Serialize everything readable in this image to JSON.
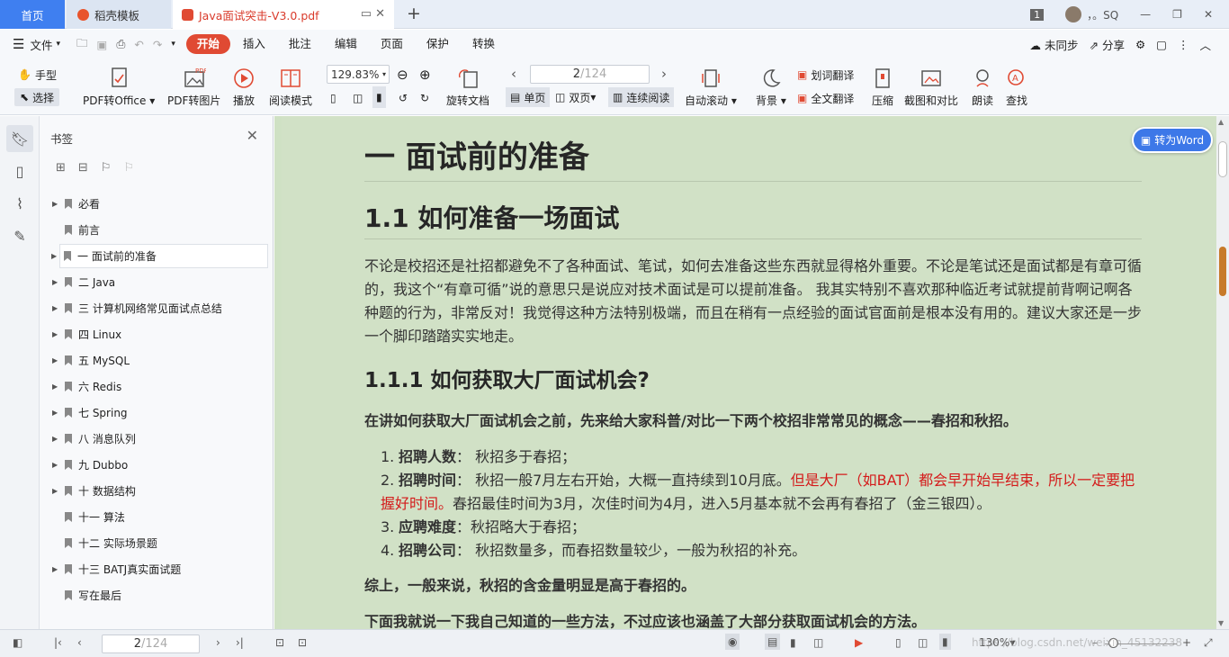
{
  "tabs": {
    "home": "首页",
    "docer": "稻壳模板",
    "pdf": "Java面试突击-V3.0.pdf",
    "new_tab": "+"
  },
  "window": {
    "badge": "1",
    "user": "，。SQ"
  },
  "ribbon": {
    "file": "文件",
    "tabs": [
      "开始",
      "插入",
      "批注",
      "编辑",
      "页面",
      "保护",
      "转换"
    ],
    "active_tab": "开始",
    "sync": "未同步",
    "share": "分享"
  },
  "toolbar": {
    "hand": "手型",
    "select": "选择",
    "pdf_to_office": "PDF转Office",
    "pdf_to_image": "PDF转图片",
    "play": "播放",
    "read_mode": "阅读模式",
    "zoom": "129.83%",
    "rotate": "旋转文档",
    "page_current": "2",
    "page_total": "/124",
    "single": "单页",
    "double": "双页",
    "continuous": "连续阅读",
    "auto_scroll": "自动滚动",
    "background": "背景",
    "word_translate": "划词翻译",
    "full_translate": "全文翻译",
    "compress": "压缩",
    "screenshot": "截图和对比",
    "read_aloud": "朗读",
    "find": "查找"
  },
  "sidebar": {
    "title": "书签",
    "items": [
      {
        "label": "必看",
        "arrow": true
      },
      {
        "label": "前言",
        "arrow": false
      },
      {
        "label": "一 面试前的准备",
        "arrow": true,
        "selected": true
      },
      {
        "label": "二 Java",
        "arrow": true
      },
      {
        "label": "三  计算机网络常见面试点总结",
        "arrow": true
      },
      {
        "label": "四 Linux",
        "arrow": true
      },
      {
        "label": "五 MySQL",
        "arrow": true
      },
      {
        "label": "六 Redis",
        "arrow": true
      },
      {
        "label": "七 Spring",
        "arrow": true
      },
      {
        "label": "八 消息队列",
        "arrow": true
      },
      {
        "label": "九 Dubbo",
        "arrow": true
      },
      {
        "label": "十 数据结构",
        "arrow": true
      },
      {
        "label": "十一 算法",
        "arrow": false
      },
      {
        "label": "十二 实际场景题",
        "arrow": false
      },
      {
        "label": "十三 BATJ真实面试题",
        "arrow": true
      },
      {
        "label": "写在最后",
        "arrow": false
      }
    ]
  },
  "doc": {
    "h1": "一 面试前的准备",
    "h2": "1.1 如何准备一场面试",
    "para1": "不论是校招还是社招都避免不了各种面试、笔试，如何去准备这些东西就显得格外重要。不论是笔试还是面试都是有章可循的，我这个“有章可循”说的意思只是说应对技术面试是可以提前准备。 我其实特别不喜欢那种临近考试就提前背啊记啊各种题的行为，非常反对！我觉得这种方法特别极端，而且在稍有一点经验的面试官面前是根本没有用的。建议大家还是一步一个脚印踏踏实实地走。",
    "h3": "1.1.1 如何获取大厂面试机会?",
    "lead": "在讲如何获取大厂面试机会之前，先来给大家科普/对比一下两个校招非常常见的概念——春招和秋招。",
    "list": [
      {
        "num": "1.",
        "term": "招聘人数",
        "text": "：  秋招多于春招；",
        "red": "",
        "rest": ""
      },
      {
        "num": "2.",
        "term": "招聘时间",
        "text": "：  秋招一般7月左右开始，大概一直持续到10月底。",
        "red": "但是大厂（如BAT）都会早开始早结束，所以一定要把握好时间。",
        "rest": "春招最佳时间为3月，次佳时间为4月，进入5月基本就不会再有春招了（金三银四）。"
      },
      {
        "num": "3.",
        "term": "应聘难度",
        "text": "：秋招略大于春招；",
        "red": "",
        "rest": ""
      },
      {
        "num": "4.",
        "term": "招聘公司",
        "text": "：  秋招数量多，而春招数量较少，一般为秋招的补充。",
        "red": "",
        "rest": ""
      }
    ],
    "summary": "综上，一般来说，秋招的含金量明显是高于春招的。",
    "next": "下面我就说一下我自己知道的一些方法，不过应该也涵盖了大部分获取面试机会的方法。"
  },
  "to_word": "转为Word",
  "status": {
    "page_current": "2",
    "page_total": "/124",
    "zoom": "130%",
    "watermark": "https://blog.csdn.net/weixin_45132238"
  }
}
